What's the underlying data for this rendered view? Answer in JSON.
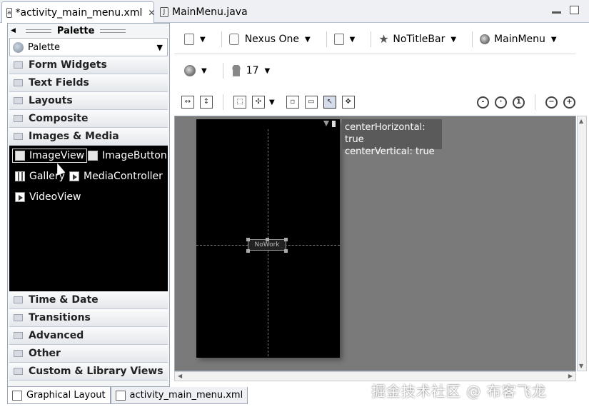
{
  "editor_tabs": [
    {
      "label": "*activity_main_menu.xml",
      "active": true
    },
    {
      "label": "MainMenu.java",
      "active": false
    }
  ],
  "palette": {
    "title": "Palette",
    "selector": "Palette",
    "categories_top": [
      "Form Widgets",
      "Text Fields",
      "Layouts",
      "Composite",
      "Images & Media"
    ],
    "widgets": [
      "ImageView",
      "ImageButton",
      "Gallery",
      "MediaController",
      "VideoView"
    ],
    "categories_bottom": [
      "Time & Date",
      "Transitions",
      "Advanced",
      "Other",
      "Custom & Library Views"
    ]
  },
  "toolbar": {
    "device": "Nexus One",
    "theme": "NoTitleBar",
    "activity": "MainMenu",
    "api_level": "17"
  },
  "canvas": {
    "tooltip_line1": "centerHorizontal: true",
    "tooltip_line2": "centerVertical: true",
    "selected_widget_text": "NoWork"
  },
  "bottom_tabs": [
    "Graphical Layout",
    "activity_main_menu.xml"
  ],
  "watermark": "掘金技术社区 @ 布客飞龙"
}
